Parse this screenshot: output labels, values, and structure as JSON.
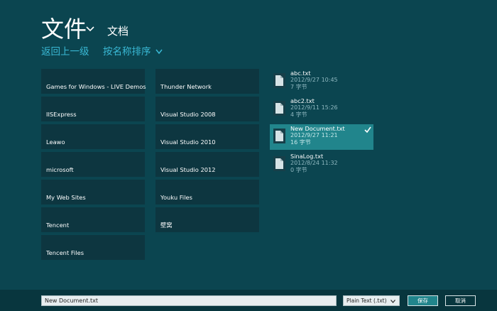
{
  "header": {
    "title": "文件",
    "location": "文档",
    "nav_up": "返回上一级",
    "sort": "按名称排序"
  },
  "folders": [
    {
      "label": "Games for Windows - LIVE Demos"
    },
    {
      "label": "IISExpress"
    },
    {
      "label": "Leawo"
    },
    {
      "label": "microsoft"
    },
    {
      "label": "My Web Sites"
    },
    {
      "label": "Tencent"
    },
    {
      "label": "Tencent Files"
    },
    {
      "label": "Thunder Network"
    },
    {
      "label": "Visual Studio 2008"
    },
    {
      "label": "Visual Studio 2010"
    },
    {
      "label": "Visual Studio 2012"
    },
    {
      "label": "Youku Files"
    },
    {
      "label": "壁窝"
    }
  ],
  "files": [
    {
      "name": "abc.txt",
      "date": "2012/9/27 10:45",
      "size": "7 字节",
      "selected": false
    },
    {
      "name": "abc2.txt",
      "date": "2012/9/11 15:26",
      "size": "4 字节",
      "selected": false
    },
    {
      "name": "New Document.txt",
      "date": "2012/9/27 11:21",
      "size": "16 字节",
      "selected": true
    },
    {
      "name": "SinaLog.txt",
      "date": "2012/8/24 11:32",
      "size": "0 字节",
      "selected": false
    }
  ],
  "bottom": {
    "filename_value": "New Document.txt",
    "file_type": "Plain Text (.txt)",
    "save_label": "保存",
    "cancel_label": "取消"
  },
  "colors": {
    "background": "#0b4550",
    "tile": "#0d3640",
    "accent_link": "#39b8d4",
    "selected": "#21858c"
  }
}
